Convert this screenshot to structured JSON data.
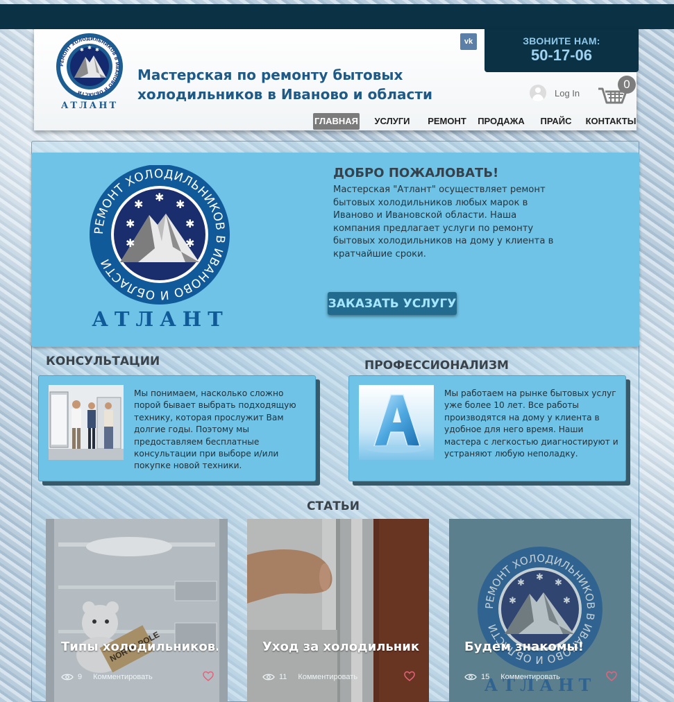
{
  "header": {
    "logo_text": "АТЛАНТ",
    "logo_ring_text": "РЕМОНТ ХОЛОДИЛЬНИКОВ В ИВАНОВО И ОБЛАСТИ",
    "site_title": "Мастерская по ремонту бытовых холодильников в Иваново и области",
    "vk_label": "vk",
    "call_label": "ЗВОНИТЕ НАМ:",
    "call_number": "50-17-06",
    "login_label": "Log In",
    "cart_count": "0"
  },
  "nav": {
    "items": [
      {
        "label": "ГЛАВНАЯ",
        "active": true
      },
      {
        "label": "УСЛУГИ"
      },
      {
        "label": "РЕМОНТ"
      },
      {
        "label": "ПРОДАЖА"
      },
      {
        "label": "ПРАЙС"
      },
      {
        "label": "КОНТАКТЫ"
      }
    ]
  },
  "hero": {
    "logo_text": "АТЛАНТ",
    "logo_ring_text": "РЕМОНТ ХОЛОДИЛЬНИКОВ В ИВАНОВО И ОБЛАСТИ",
    "title": "ДОБРО ПОЖАЛОВАТЬ!",
    "text": "Мастерская \"Атлант\" осуществляет ремонт бытовых холодильников любых марок в Иваново и Ивановской области. Наша компания предлагает услуги по ремонту бытовых холодильников на дому у клиента в кратчайшие сроки.",
    "button_label": "ЗАКАЗАТЬ УСЛУГУ"
  },
  "features": {
    "consult": {
      "title": "КОНСУЛЬТАЦИИ",
      "text": "Мы понимаем, насколько сложно порой бывает выбрать подходящую технику, которая прослужит Вам долгие годы. Поэтому мы предоставляем бесплатные консультации при выборе и/или покупке новой техники."
    },
    "pro": {
      "title": "ПРОФЕССИОНАЛИЗМ",
      "text": "Мы работаем на рынке бытовых услуг уже более 10 лет.  Все работы производятся на дому у клиента в удобное для него время. Наши мастера с легкостью диагностируют и устраняют любую неполадку."
    }
  },
  "articles": {
    "title": "СТАТЬИ",
    "comment_label": "Комментировать",
    "posts": [
      {
        "title": "Типы холодильников. ...",
        "views": "9",
        "photo_sign": "NORTH POLE"
      },
      {
        "title": "Уход за холодильнико...",
        "views": "11"
      },
      {
        "title": "Будем знакомы!",
        "views": "15",
        "logo_text": "АТЛАНТ"
      }
    ]
  },
  "colors": {
    "dark_navy": "#0b3144",
    "hero_blue": "#6fc3e6",
    "title_blue": "#1f5a86",
    "button_bg": "#226a8e",
    "heart": "#e4637b"
  }
}
